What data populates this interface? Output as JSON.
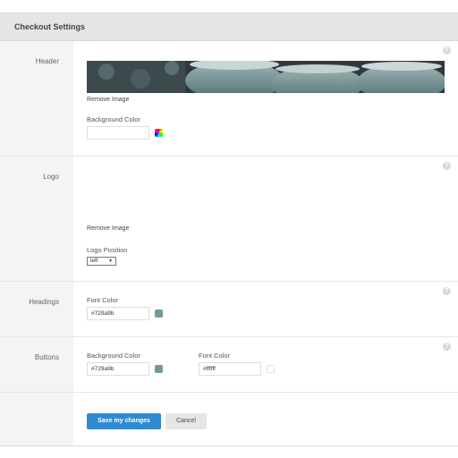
{
  "panel": {
    "title": "Checkout Settings"
  },
  "help_glyph": "?",
  "header": {
    "label": "Header",
    "remove_image": "Remove Image",
    "bg_color_label": "Background Color",
    "bg_color_value": "",
    "swatch_icon": "color-wheel-icon"
  },
  "logo": {
    "label": "Logo",
    "remove_image": "Remove Image",
    "position_label": "Logo Position",
    "position_value": "left",
    "caret": "▼"
  },
  "headings": {
    "label": "Headings",
    "font_color_label": "Font Color",
    "font_color_value": "#729a9b",
    "swatch_color": "#729a9b"
  },
  "buttons": {
    "label": "Buttons",
    "bg_color_label": "Background Color",
    "bg_color_value": "#729a9b",
    "bg_swatch_color": "#729a9b",
    "font_color_label": "Font Color",
    "font_color_value": "#ffffff",
    "font_swatch_color": "#ffffff"
  },
  "actions": {
    "save_label": "Save my changes",
    "cancel_label": "Cancel"
  },
  "colors": {
    "primary": "#2f8bd1",
    "accent": "#729a9b"
  }
}
